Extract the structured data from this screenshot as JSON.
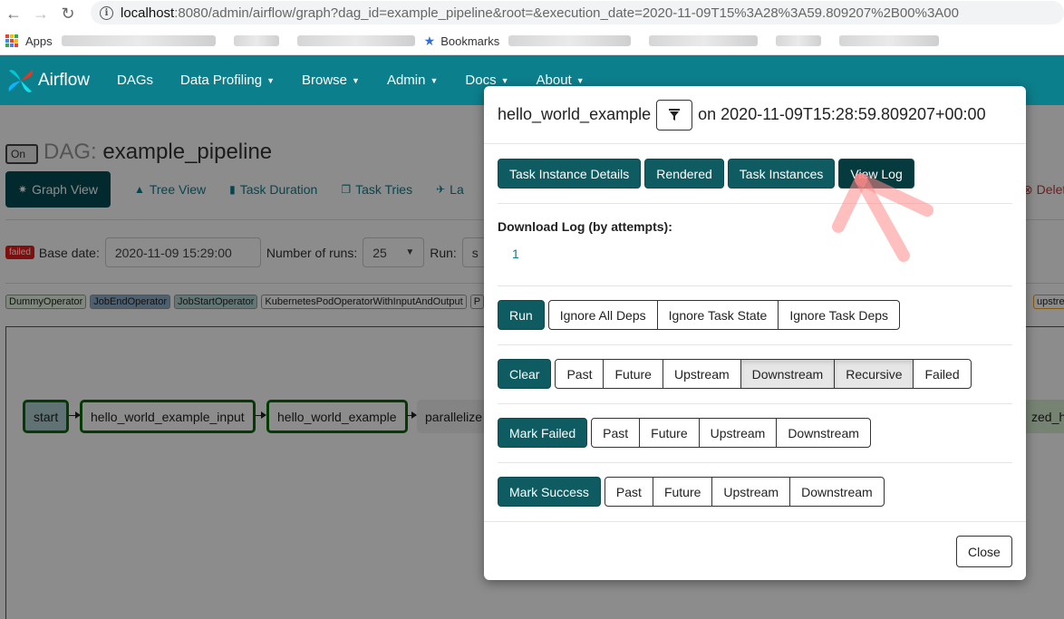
{
  "browser": {
    "url_host": "localhost",
    "url_rest": ":8080/admin/airflow/graph?dag_id=example_pipeline&root=&execution_date=2020-11-09T15%3A28%3A59.809207%2B00%3A00",
    "bookmarks_apps": "Apps",
    "bookmarks_label": "Bookmarks"
  },
  "navbar": {
    "brand": "Airflow",
    "items": [
      {
        "label": "DAGs",
        "caret": false
      },
      {
        "label": "Data Profiling",
        "caret": true
      },
      {
        "label": "Browse",
        "caret": true
      },
      {
        "label": "Admin",
        "caret": true
      },
      {
        "label": "Docs",
        "caret": true
      },
      {
        "label": "About",
        "caret": true
      }
    ]
  },
  "page": {
    "toggle": "On",
    "dag_prefix": "DAG:",
    "dag_name": "example_pipeline",
    "tabs": [
      "Graph View",
      "Tree View",
      "Task Duration",
      "Task Tries",
      "La"
    ],
    "delete_label": "Delet",
    "status_badge": "failed",
    "base_date_label": "Base date:",
    "base_date_value": "2020-11-09 15:29:00",
    "num_runs_label": "Number of runs:",
    "num_runs_value": "25",
    "run_label": "Run:",
    "run_value": "s",
    "operators": [
      "DummyOperator",
      "JobEndOperator",
      "JobStartOperator",
      "KubernetesPodOperatorWithInputAndOutput",
      "P"
    ],
    "operator_right": "upstre",
    "nodes": [
      "start",
      "hello_world_example_input",
      "hello_world_example",
      "parallelize",
      "zed_he"
    ]
  },
  "modal": {
    "task_id": "hello_world_example",
    "on_label": "on",
    "execution_date": "2020-11-09T15:28:59.809207+00:00",
    "top_buttons": [
      "Task Instance Details",
      "Rendered",
      "Task Instances",
      "View Log"
    ],
    "download_title": "Download Log (by attempts):",
    "attempts": [
      "1"
    ],
    "run": {
      "primary": "Run",
      "options": [
        "Ignore All Deps",
        "Ignore Task State",
        "Ignore Task Deps"
      ]
    },
    "clear": {
      "primary": "Clear",
      "options": [
        "Past",
        "Future",
        "Upstream",
        "Downstream",
        "Recursive",
        "Failed"
      ]
    },
    "mark_failed": {
      "primary": "Mark Failed",
      "options": [
        "Past",
        "Future",
        "Upstream",
        "Downstream"
      ]
    },
    "mark_success": {
      "primary": "Mark Success",
      "options": [
        "Past",
        "Future",
        "Upstream",
        "Downstream"
      ]
    },
    "close_label": "Close"
  },
  "colors": {
    "navbar": "#0c7f8c",
    "primary_button": "#0f5b62",
    "failed_badge": "#e61c1c",
    "node_success_border": "#0a6b0a"
  }
}
